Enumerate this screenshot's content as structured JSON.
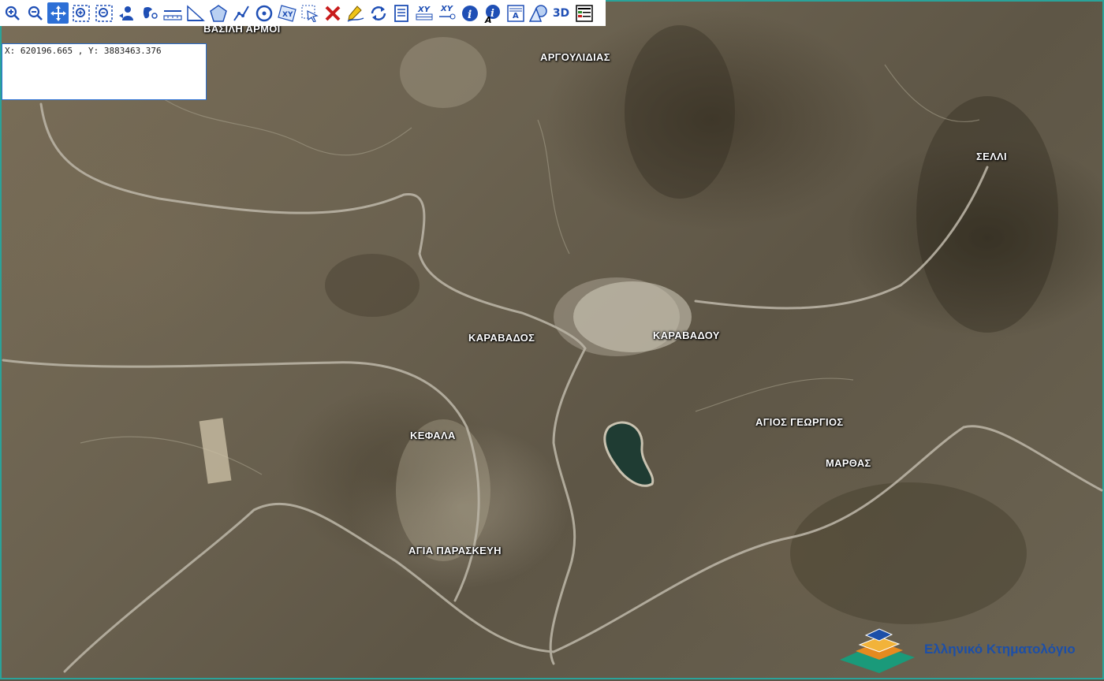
{
  "coordinates": {
    "text": "X: 620196.665 , Y: 3883463.376"
  },
  "toolbar": {
    "xy_label": "XY",
    "xy2_label": "XY",
    "label_tool": "A",
    "three_d": "3D",
    "icons": [
      "zoom-in-icon",
      "zoom-out-icon",
      "pan-icon",
      "zoom-box-icon",
      "zoom-extent-icon",
      "user-location-icon",
      "globe-icon",
      "measure-distance-icon",
      "measure-angle-icon",
      "polygon-icon",
      "polyline-icon",
      "circle-icon",
      "select-xy-icon",
      "select-arrow-icon",
      "clear-icon",
      "edit-pencil-icon",
      "refresh-icon",
      "document-icon",
      "xy-table-icon",
      "xy-goto-icon",
      "info-icon",
      "info-text-icon",
      "label-icon",
      "shape-icon",
      "3d-icon",
      "legend-icon"
    ]
  },
  "labels": {
    "vasili_armoi": "ΒΑΣΙΛΗ ΑΡΜΟΙ",
    "argoulidias": "ΑΡΓΟΥΛΙΔΙΑΣ",
    "selli": "ΣΕΛΛΙ",
    "karavados": "ΚΑΡΑΒΑΔΟΣ",
    "karavadou": "ΚΑΡΑΒΑΔΟΥ",
    "agios_georgios": "ΑΓΙΟΣ ΓΕΩΡΓΙΟΣ",
    "marthas": "ΜΑΡΘΑΣ",
    "kefala": "ΚΕΦΑΛΑ",
    "agia_paraskevi": "ΑΓΙΑ ΠΑΡΑΣΚΕΥΗ"
  },
  "logo": {
    "text": "Ελληνικό Κτηματολόγιο"
  },
  "colors": {
    "toolbar_accent": "#2d6fd6",
    "map_border": "#2aa39a",
    "logo_blue": "#1c4fa8",
    "logo_green": "#1a9a7a"
  }
}
